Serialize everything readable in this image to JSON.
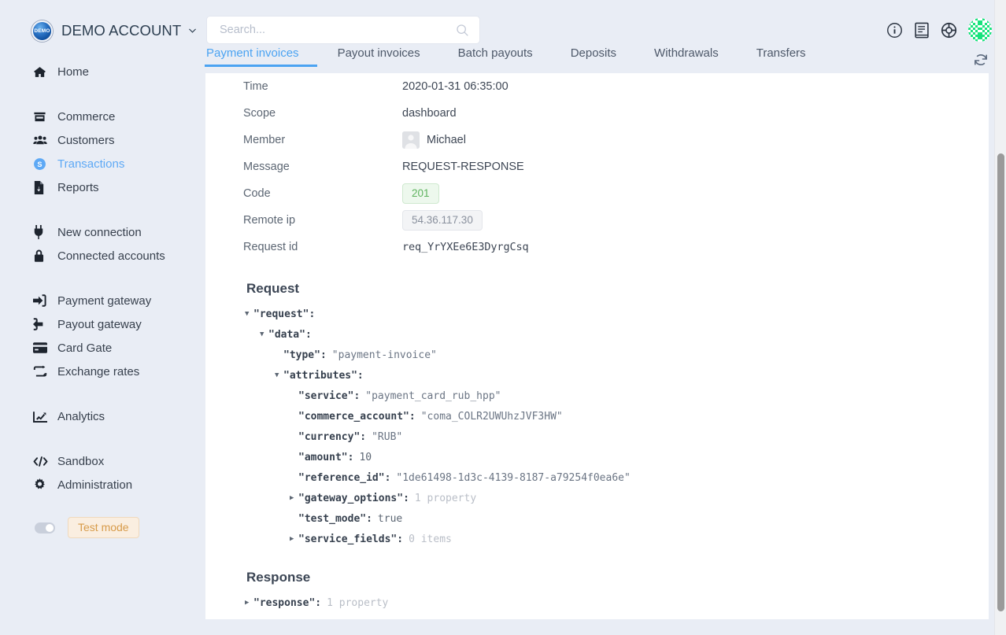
{
  "sidebar": {
    "account": {
      "logo_text": "DEMO",
      "name": "DEMO ACCOUNT",
      "caret": "chevron-down"
    },
    "groups": [
      {
        "items": [
          {
            "icon": "home-icon",
            "label": "Home",
            "active": false
          }
        ]
      },
      {
        "items": [
          {
            "icon": "store-icon",
            "label": "Commerce",
            "active": false
          },
          {
            "icon": "users-icon",
            "label": "Customers",
            "active": false
          },
          {
            "icon": "dollar-circle-icon",
            "label": "Transactions",
            "active": true
          },
          {
            "icon": "report-file-icon",
            "label": "Reports",
            "active": false
          }
        ]
      },
      {
        "items": [
          {
            "icon": "plug-icon",
            "label": "New connection",
            "active": false
          },
          {
            "icon": "lock-icon",
            "label": "Connected accounts",
            "active": false
          }
        ]
      },
      {
        "items": [
          {
            "icon": "sign-in-icon",
            "label": "Payment gateway",
            "active": false
          },
          {
            "icon": "sign-out-icon",
            "label": "Payout gateway",
            "active": false
          },
          {
            "icon": "credit-card-icon",
            "label": "Card Gate",
            "active": false
          },
          {
            "icon": "exchange-icon",
            "label": "Exchange rates",
            "active": false
          }
        ]
      },
      {
        "items": [
          {
            "icon": "chart-line-icon",
            "label": "Analytics",
            "active": false
          }
        ]
      },
      {
        "items": [
          {
            "icon": "code-icon",
            "label": "Sandbox",
            "active": false
          },
          {
            "icon": "gear-icon",
            "label": "Administration",
            "active": false
          }
        ]
      }
    ],
    "test_mode": {
      "label": "Test mode",
      "enabled": false
    }
  },
  "topbar": {
    "search": {
      "value": "",
      "placeholder": "Search..."
    },
    "tabs": [
      {
        "label": "Payment invoices",
        "active": true
      },
      {
        "label": "Payout invoices",
        "active": false
      },
      {
        "label": "Batch payouts",
        "active": false
      },
      {
        "label": "Deposits",
        "active": false
      },
      {
        "label": "Withdrawals",
        "active": false
      },
      {
        "label": "Transfers",
        "active": false
      }
    ],
    "icons": [
      {
        "name": "info-circle-icon"
      },
      {
        "name": "book-icon"
      },
      {
        "name": "lifebuoy-icon"
      }
    ],
    "avatar": "identicon-avatar",
    "refresh": "refresh-icon"
  },
  "detail": {
    "rows": [
      {
        "label": "Time",
        "value": "2020-01-31 06:35:00",
        "kind": "text"
      },
      {
        "label": "Scope",
        "value": "dashboard",
        "kind": "text"
      },
      {
        "label": "Member",
        "value": "Michael",
        "kind": "member"
      },
      {
        "label": "Message",
        "value": "REQUEST-RESPONSE",
        "kind": "text"
      },
      {
        "label": "Code",
        "value": "201",
        "kind": "badge-green"
      },
      {
        "label": "Remote ip",
        "value": "54.36.117.30",
        "kind": "badge-gray"
      },
      {
        "label": "Request id",
        "value": "req_YrYXEe6E3DyrgCsq",
        "kind": "mono"
      }
    ]
  },
  "request_section": {
    "title": "Request",
    "lines": [
      {
        "indent": 0,
        "arrow": "open",
        "key": "\"request\"",
        "sep": ":",
        "val": "",
        "valtype": "none"
      },
      {
        "indent": 1,
        "arrow": "open",
        "key": "\"data\"",
        "sep": ":",
        "val": "",
        "valtype": "none"
      },
      {
        "indent": 2,
        "arrow": "none",
        "key": "\"type\"",
        "sep": ":",
        "val": "\"payment-invoice\"",
        "valtype": "string"
      },
      {
        "indent": 2,
        "arrow": "open",
        "key": "\"attributes\"",
        "sep": ":",
        "val": "",
        "valtype": "none"
      },
      {
        "indent": 3,
        "arrow": "none",
        "key": "\"service\"",
        "sep": ":",
        "val": "\"payment_card_rub_hpp\"",
        "valtype": "string"
      },
      {
        "indent": 3,
        "arrow": "none",
        "key": "\"commerce_account\"",
        "sep": ":",
        "val": "\"coma_COLR2UWUhzJVF3HW\"",
        "valtype": "string"
      },
      {
        "indent": 3,
        "arrow": "none",
        "key": "\"currency\"",
        "sep": ":",
        "val": "\"RUB\"",
        "valtype": "string"
      },
      {
        "indent": 3,
        "arrow": "none",
        "key": "\"amount\"",
        "sep": ":",
        "val": "10",
        "valtype": "number"
      },
      {
        "indent": 3,
        "arrow": "none",
        "key": "\"reference_id\"",
        "sep": ":",
        "val": "\"1de61498-1d3c-4139-8187-a79254f0ea6e\"",
        "valtype": "string"
      },
      {
        "indent": 3,
        "arrow": "closed",
        "key": "\"gateway_options\"",
        "sep": ":",
        "val": "1 property",
        "valtype": "meta"
      },
      {
        "indent": 3,
        "arrow": "none",
        "key": "\"test_mode\"",
        "sep": ":",
        "val": "true",
        "valtype": "bool"
      },
      {
        "indent": 3,
        "arrow": "closed",
        "key": "\"service_fields\"",
        "sep": ":",
        "val": "0 items",
        "valtype": "meta"
      }
    ]
  },
  "response_section": {
    "title": "Response",
    "lines": [
      {
        "indent": 0,
        "arrow": "closed",
        "key": "\"response\"",
        "sep": ":",
        "val": "1 property",
        "valtype": "meta"
      }
    ]
  },
  "colors": {
    "accent": "#4ba3f2",
    "sidebar_bg": "#e9edf5",
    "card_bg": "#ffffff",
    "code_badge_text": "#5eb35e",
    "test_mode_text": "#d79b4a"
  }
}
